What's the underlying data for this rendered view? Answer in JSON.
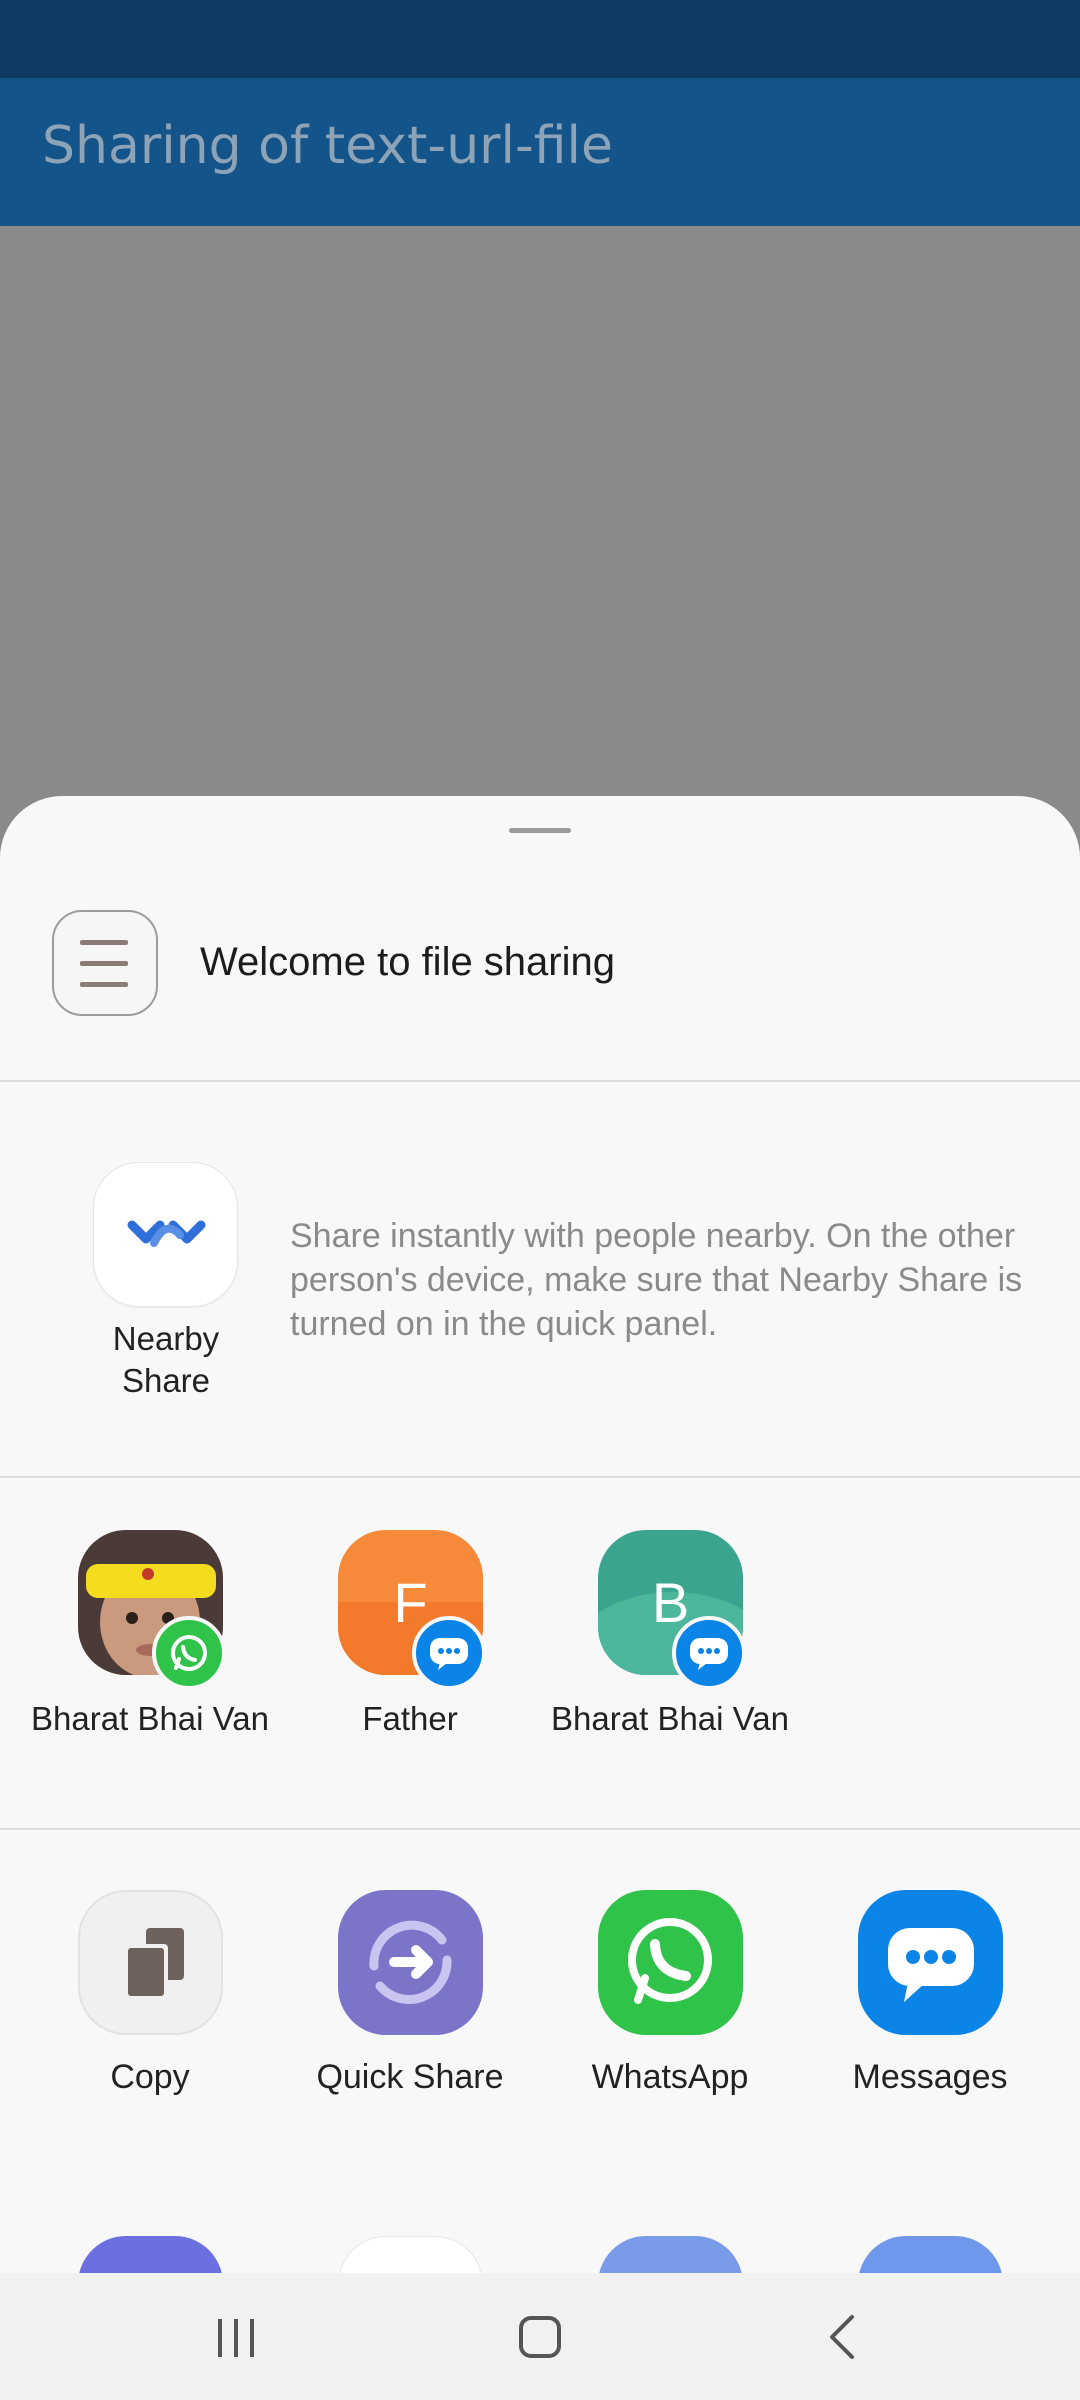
{
  "app_bar": {
    "title": "Sharing of text-url-file"
  },
  "sheet": {
    "header_title": "Welcome to file sharing",
    "nearby": {
      "label": "Nearby Share",
      "description": "Share instantly with people nearby. On the other person's device, make sure that Nearby Share is turned on in the quick panel."
    },
    "contacts": [
      {
        "name": "Bharat Bhai Van",
        "avatar": "photo",
        "badge": "whatsapp-icon"
      },
      {
        "name": "Father",
        "avatar_letter": "F",
        "avatar_color": "#f7893a",
        "badge": "messages-icon"
      },
      {
        "name": "Bharat Bhai Van",
        "avatar_letter": "B",
        "avatar_color": "#3aa48f",
        "badge": "messages-icon"
      }
    ],
    "apps": [
      {
        "label": "Copy",
        "icon": "copy-icon"
      },
      {
        "label": "Quick Share",
        "icon": "quick-share-icon"
      },
      {
        "label": "WhatsApp",
        "icon": "whatsapp-icon"
      },
      {
        "label": "Messages",
        "icon": "messages-icon"
      }
    ]
  },
  "colors": {
    "status_bar": "#0f3a63",
    "app_bar": "#13548a",
    "whatsapp": "#2fc34a",
    "messages": "#0a84e6",
    "quick_share": "#7c74c9"
  },
  "nav": {
    "buttons": [
      "recents-icon",
      "home-icon",
      "back-icon"
    ]
  }
}
